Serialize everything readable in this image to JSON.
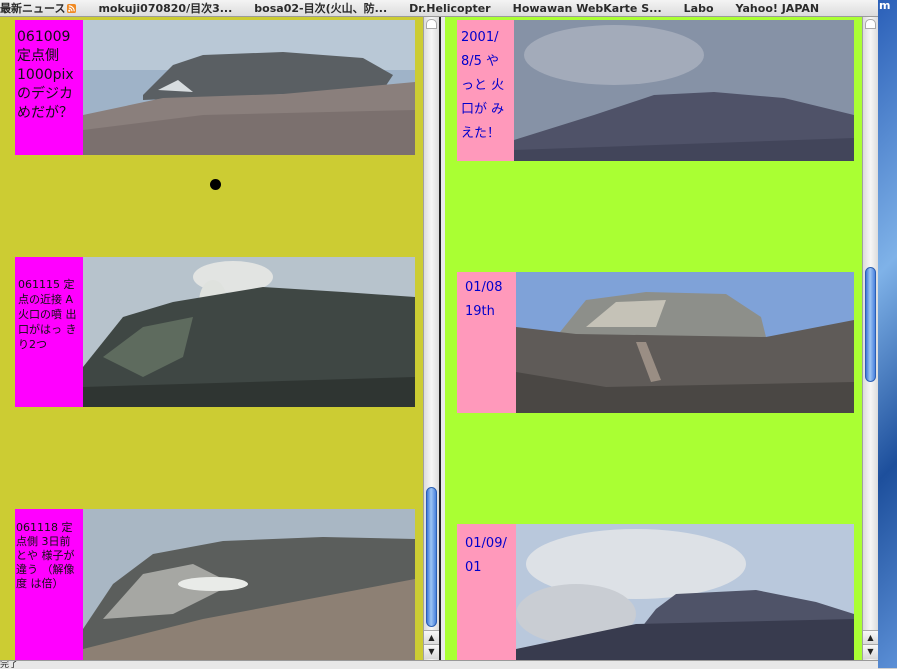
{
  "bookmarks": [
    {
      "label": "最新ニュース",
      "has_rss": true
    },
    {
      "label": "mokuji070820/目次3..."
    },
    {
      "label": "bosa02-目次(火山、防..."
    },
    {
      "label": "Dr.Helicopter"
    },
    {
      "label": "Howawan WebKarte S..."
    },
    {
      "label": "Labo"
    },
    {
      "label": "Yahoo! JAPAN"
    }
  ],
  "desktop_label": "m",
  "left_frame": {
    "background": "#cccc33",
    "entries": [
      {
        "label": "061009 定点側 1000pix のデジカ めだが？"
      },
      {
        "label": "061115 定点の近接 A火口の噴 出口がはっ きり2つ"
      },
      {
        "label": "061118 定点側 3日前とや 様子が違う （解像度 は倍）"
      }
    ]
  },
  "right_frame": {
    "background": "#aaff33",
    "entries": [
      {
        "label": "2001/ 8/5 やっと 火口が みえた！"
      },
      {
        "label": "01/08 19th"
      },
      {
        "label": "01/09/ 01"
      }
    ]
  },
  "status": {
    "text": "完了"
  },
  "colors": {
    "label_left": "#ff00ff",
    "label_right": "#ff99bb",
    "label_right_text": "#0000cc",
    "scroll_thumb": "#4a82de"
  },
  "scroll": {
    "left_position": 0.78,
    "right_position": 0.43
  }
}
